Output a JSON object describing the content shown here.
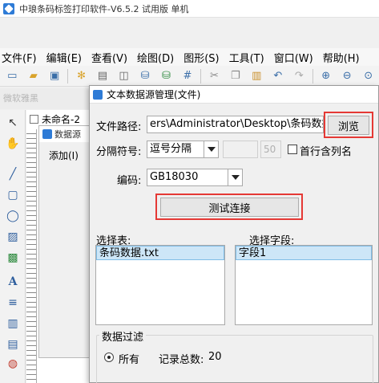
{
  "window": {
    "title": "中琅条码标签打印软件-V6.5.2 试用版 单机"
  },
  "menu": [
    "文件(F)",
    "编辑(E)",
    "查看(V)",
    "绘图(D)",
    "图形(S)",
    "工具(T)",
    "窗口(W)",
    "帮助(H)"
  ],
  "toolbar2": {
    "font_name": "微软雅黑"
  },
  "document": {
    "tab_label": "未命名-2"
  },
  "back_dialog": {
    "title": "数据源",
    "add_label": "添加(I)"
  },
  "dialog": {
    "title": "文本数据源管理(文件)",
    "file_path_label": "文件路径:",
    "file_path_value": "ers\\Administrator\\Desktop\\条码数据.txt",
    "browse_label": "浏览",
    "separator_label": "分隔符号:",
    "separator_value": "逗号分隔",
    "separator_number": "50",
    "first_row_label": "首行含列名",
    "encoding_label": "编码:",
    "encoding_value": "GB18030",
    "test_label": "测试连接",
    "select_table_label": "选择表:",
    "select_field_label": "选择字段:",
    "tables": [
      "条码数据.txt"
    ],
    "fields": [
      "字段1"
    ],
    "filter_label": "数据过滤",
    "filter_all_label": "所有",
    "total_label": "记录总数:",
    "total_value": "20"
  },
  "colors": {
    "highlight_box": "#e53935",
    "selection": "#cde6f7"
  }
}
